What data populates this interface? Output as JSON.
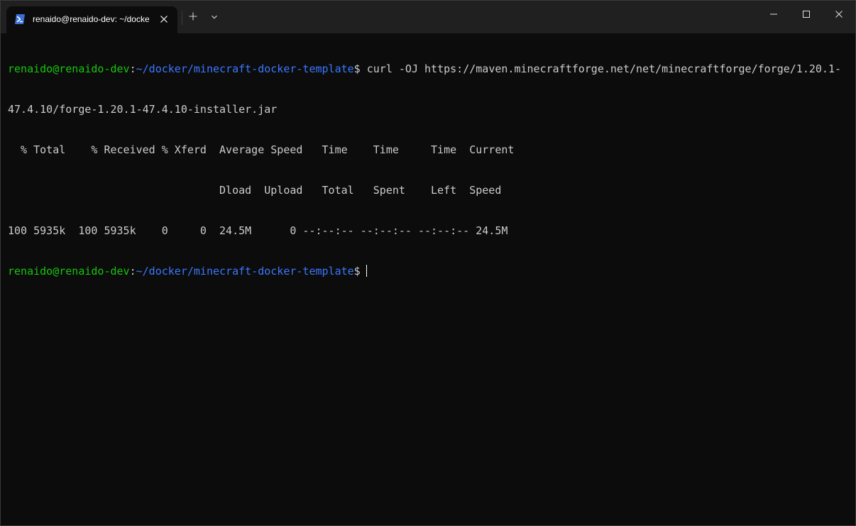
{
  "window": {
    "tab": {
      "title": "renaido@renaido-dev: ~/docker/minecraft-docker-template",
      "icon": "powershell-icon"
    },
    "controls": {
      "new_tab_icon": "plus-icon",
      "dropdown_icon": "chevron-down-icon",
      "minimize_icon": "minimize-icon",
      "maximize_icon": "maximize-icon",
      "close_icon": "close-icon"
    }
  },
  "terminal": {
    "colors": {
      "background": "#0c0c0c",
      "foreground": "#cccccc",
      "prompt_user": "#16c60c",
      "prompt_path": "#3b78ff"
    },
    "prompt1": {
      "user_host": "renaido@renaido-dev",
      "colon": ":",
      "path": "~/docker/minecraft-docker-template",
      "symbol": "$",
      "command": " curl -OJ https://maven.minecraftforge.net/net/minecraftforge/forge/1.20.1-"
    },
    "command_wrap": "47.4.10/forge-1.20.1-47.4.10-installer.jar",
    "output": [
      "  % Total    % Received % Xferd  Average Speed   Time    Time     Time  Current",
      "                                 Dload  Upload   Total   Spent    Left  Speed",
      "100 5935k  100 5935k    0     0  24.5M      0 --:--:-- --:--:-- --:--:-- 24.5M"
    ],
    "prompt2": {
      "user_host": "renaido@renaido-dev",
      "colon": ":",
      "path": "~/docker/minecraft-docker-template",
      "symbol": "$"
    }
  }
}
